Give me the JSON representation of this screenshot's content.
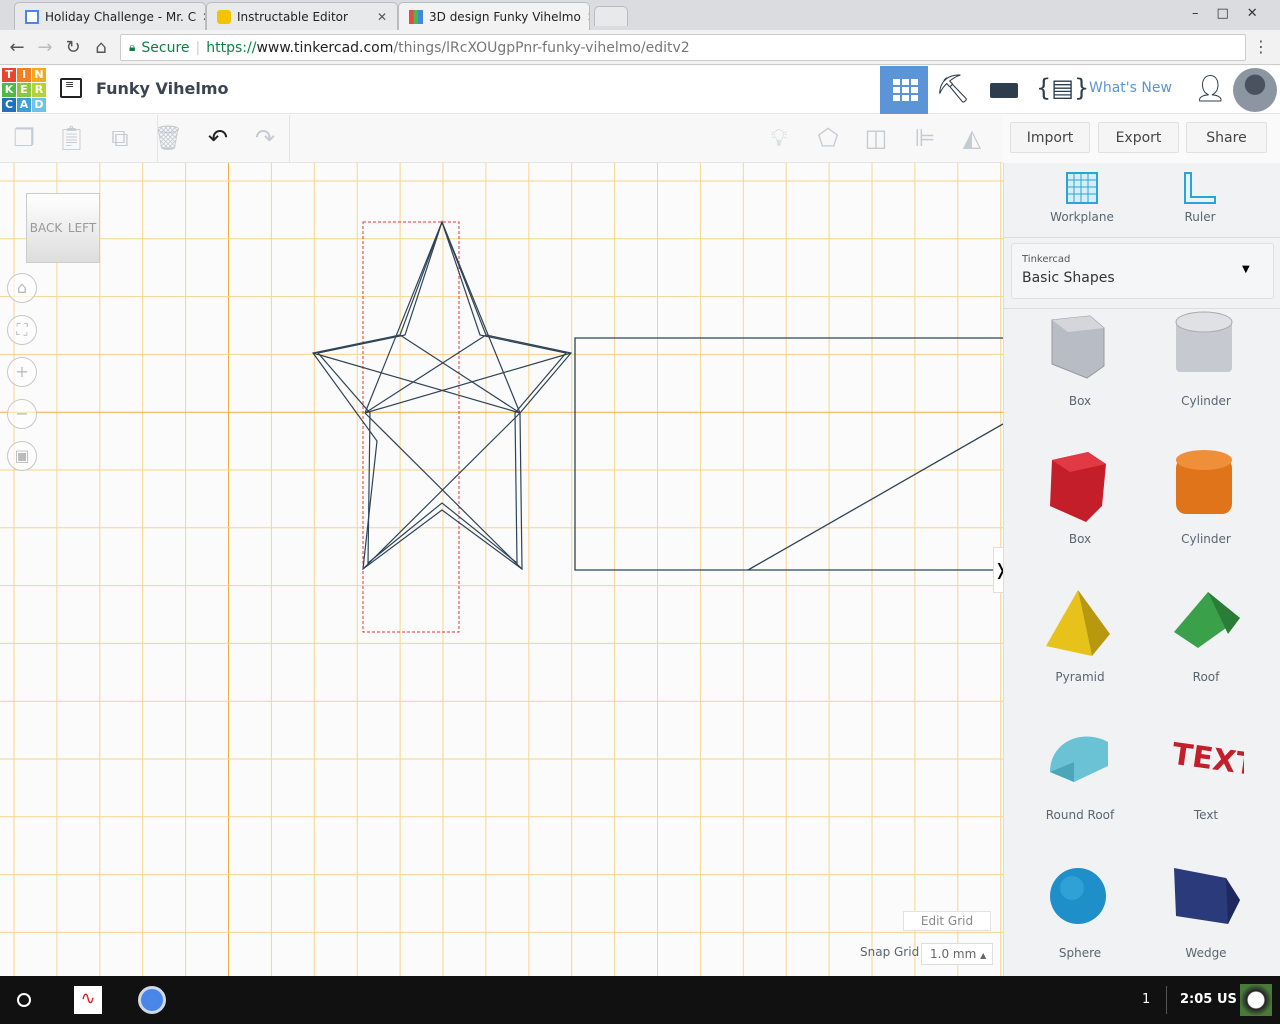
{
  "browser": {
    "tabs": [
      {
        "title": "Holiday Challenge - Mr. C",
        "active": false
      },
      {
        "title": "Instructable Editor",
        "active": false
      },
      {
        "title": "3D design Funky Vihelmo",
        "active": true
      }
    ],
    "secure_label": "Secure",
    "url_scheme": "https://",
    "url_host": "www.tinkercad.com",
    "url_path": "/things/lRcXOUgpPnr-funky-vihelmo/editv2"
  },
  "app": {
    "logo_letters": [
      "T",
      "I",
      "N",
      "K",
      "E",
      "R",
      "C",
      "A",
      "D"
    ],
    "design_title": "Funky Vihelmo",
    "whats_new": "What's New",
    "accent": "#5b95d8"
  },
  "toolbar": {
    "import": "Import",
    "export": "Export",
    "share": "Share"
  },
  "viewcube": {
    "back": "BACK",
    "left": "LEFT"
  },
  "panel": {
    "workplane": "Workplane",
    "ruler": "Ruler",
    "library_source": "Tinkercad",
    "library_name": "Basic Shapes",
    "shapes": [
      {
        "label": "Box",
        "icon": "box-hole-icon"
      },
      {
        "label": "Cylinder",
        "icon": "cylinder-hole-icon"
      },
      {
        "label": "Box",
        "icon": "box-red-icon"
      },
      {
        "label": "Cylinder",
        "icon": "cylinder-orange-icon"
      },
      {
        "label": "Pyramid",
        "icon": "pyramid-icon"
      },
      {
        "label": "Roof",
        "icon": "roof-icon"
      },
      {
        "label": "Round Roof",
        "icon": "round-roof-icon"
      },
      {
        "label": "Text",
        "icon": "text-icon"
      },
      {
        "label": "Sphere",
        "icon": "sphere-icon"
      },
      {
        "label": "Wedge",
        "icon": "wedge-icon"
      }
    ]
  },
  "grid": {
    "edit_grid": "Edit Grid",
    "snap_label": "Snap Grid",
    "snap_value": "1.0 mm"
  },
  "taskbar": {
    "count": "1",
    "time": "2:05",
    "locale": "US"
  }
}
